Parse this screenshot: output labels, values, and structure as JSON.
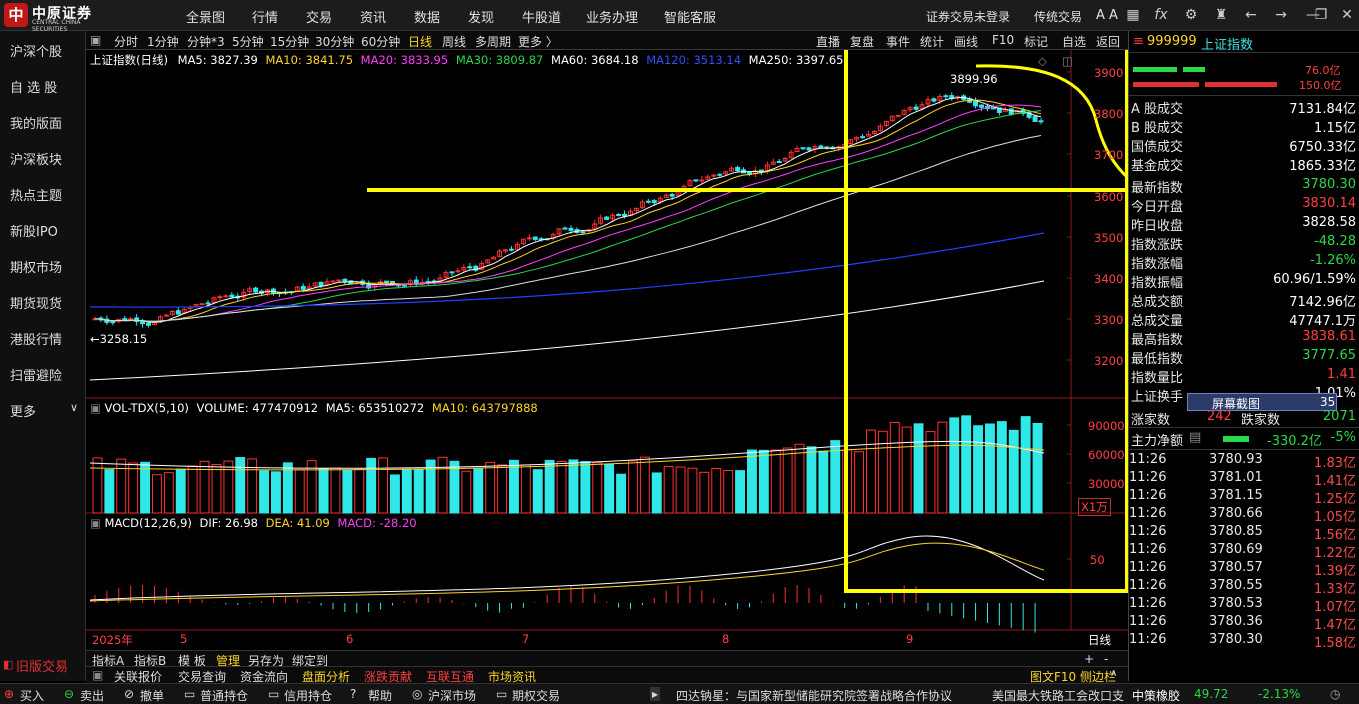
{
  "app": {
    "logo_cn": "中原证券",
    "logo_en": "CENTRAL CHINA SECURITIES",
    "menu": [
      "全景图",
      "行情",
      "交易",
      "资讯",
      "数据",
      "发现",
      "牛股道",
      "业务办理",
      "智能客服"
    ],
    "login_status": "证券交易未登录",
    "trade_mode": "传统交易",
    "font_btn": "A A"
  },
  "sidebar": {
    "items": [
      "沪深个股",
      "自 选 股",
      "我的版面",
      "沪深板块",
      "热点主题",
      "新股IPO",
      "期权市场",
      "期货现货",
      "港股行情",
      "扫雷避险",
      "更多"
    ],
    "old_trade": "旧版交易"
  },
  "period_tabs": {
    "items": [
      "分时",
      "1分钟",
      "分钟*3",
      "5分钟",
      "15分钟",
      "30分钟",
      "60分钟",
      "日线",
      "周线",
      "多周期",
      "更多 〉"
    ],
    "active": "日线",
    "right_tools": [
      "直播",
      "复盘",
      "事件",
      "统计",
      "画线",
      "F10",
      "标记",
      "自选",
      "返回"
    ]
  },
  "ma_legend": {
    "title": "上证指数(日线)",
    "ma5": "MA5: 3827.39",
    "ma10": "MA10: 3841.75",
    "ma20": "MA20: 3833.95",
    "ma30": "MA30: 3809.87",
    "ma60": "MA60: 3684.18",
    "ma120": "MA120: 3513.14",
    "ma250": "MA250: 3397.65"
  },
  "vol_legend": {
    "title": "VOL-TDX(5,10)",
    "volume": "VOLUME: 477470912",
    "ma5": "MA5: 653510272",
    "ma10": "MA10: 643797888"
  },
  "macd_legend": {
    "title": "MACD(12,26,9)",
    "dif": "DIF: 26.98",
    "dea": "DEA: 41.09",
    "macd": "MACD: -28.20"
  },
  "annotations": {
    "high_label": "3899.96",
    "low_label": "3258.15",
    "vol_unit": "X1万",
    "period_label": "日线"
  },
  "chart_data": {
    "type": "candlestick",
    "price_axis": [
      3900,
      3800,
      3700,
      3600,
      3500,
      3400,
      3300,
      3200
    ],
    "vol_axis": [
      90000,
      60000,
      30000
    ],
    "macd_axis": [
      50.0
    ],
    "time_axis": [
      "2025年",
      "5",
      "6",
      "7",
      "8",
      "9"
    ],
    "ma_colors": {
      "ma5": "#ffffff",
      "ma10": "#ffd42a",
      "ma20": "#ff40ff",
      "ma30": "#2bd84a",
      "ma60": "#dddddd",
      "ma120": "#2040ff",
      "ma250": "#ffffff"
    }
  },
  "quote": {
    "code": "999999",
    "name": "上证指数",
    "bar1_value": "76.0亿",
    "bar2_value": "150.0亿",
    "fields": [
      {
        "k": "A 股成交",
        "v": "7131.84亿",
        "c": "white"
      },
      {
        "k": "B 股成交",
        "v": "1.15亿",
        "c": "white"
      },
      {
        "k": "国债成交",
        "v": "6750.33亿",
        "c": "white"
      },
      {
        "k": "基金成交",
        "v": "1865.33亿",
        "c": "white"
      },
      {
        "k": "最新指数",
        "v": "3780.30",
        "c": "green"
      },
      {
        "k": "今日开盘",
        "v": "3830.14",
        "c": "red"
      },
      {
        "k": "昨日收盘",
        "v": "3828.58",
        "c": "white"
      },
      {
        "k": "指数涨跌",
        "v": "-48.28",
        "c": "green"
      },
      {
        "k": "指数涨幅",
        "v": "-1.26%",
        "c": "green"
      },
      {
        "k": "指数振幅",
        "v": "60.96/1.59%",
        "c": "white"
      },
      {
        "k": "总成交额",
        "v": "7142.96亿",
        "c": "white"
      },
      {
        "k": "总成交量",
        "v": "47747.1万",
        "c": "white"
      },
      {
        "k": "最高指数",
        "v": "3838.61",
        "c": "red"
      },
      {
        "k": "最低指数",
        "v": "3777.65",
        "c": "green"
      },
      {
        "k": "指数量比",
        "v": "1.41",
        "c": "red"
      },
      {
        "k": "上证换手",
        "v": "1.01%",
        "c": "white"
      }
    ],
    "screenshot_btn": "屏幕截图",
    "screenshot_num": "35",
    "rise_label": "涨家数",
    "rise_value": "242",
    "fall_label": "跌家数",
    "fall_value": "2071",
    "flow_label": "主力净额",
    "flow_value": "-330.2亿",
    "flow_pct": "-5%",
    "ticks": [
      {
        "t": "11:26",
        "p": "3780.93",
        "q": "1.83亿"
      },
      {
        "t": "11:26",
        "p": "3781.01",
        "q": "1.41亿"
      },
      {
        "t": "11:26",
        "p": "3781.15",
        "q": "1.25亿"
      },
      {
        "t": "11:26",
        "p": "3780.66",
        "q": "1.05亿"
      },
      {
        "t": "11:26",
        "p": "3780.85",
        "q": "1.56亿"
      },
      {
        "t": "11:26",
        "p": "3780.69",
        "q": "1.22亿"
      },
      {
        "t": "11:26",
        "p": "3780.57",
        "q": "1.39亿"
      },
      {
        "t": "11:26",
        "p": "3780.55",
        "q": "1.33亿"
      },
      {
        "t": "11:26",
        "p": "3780.53",
        "q": "1.07亿"
      },
      {
        "t": "11:26",
        "p": "3780.36",
        "q": "1.47亿"
      },
      {
        "t": "11:26",
        "p": "3780.30",
        "q": "1.58亿"
      }
    ]
  },
  "bottom_tabs1": [
    "指标A",
    "指标B",
    "模 板",
    "管理",
    "另存为",
    "绑定到"
  ],
  "bottom_tabs2": [
    "关联报价",
    "交易查询",
    "资金流向",
    "盘面分析",
    "涨跌贡献",
    "互联互通",
    "市场资讯"
  ],
  "bottom_right": "图文F10  侧边栏",
  "status": {
    "items": [
      "买入",
      "卖出",
      "撤单",
      "普通持仓",
      "信用持仓",
      "帮助",
      "沪深市场",
      "期权交易"
    ],
    "news1": "四达钠星：与国家新型储能研究院签署战略合作协议",
    "news2": "美国最大铁路工会改口支",
    "stock_name": "中策橡胶",
    "stock_price": "49.72",
    "stock_pct": "-2.13%"
  }
}
